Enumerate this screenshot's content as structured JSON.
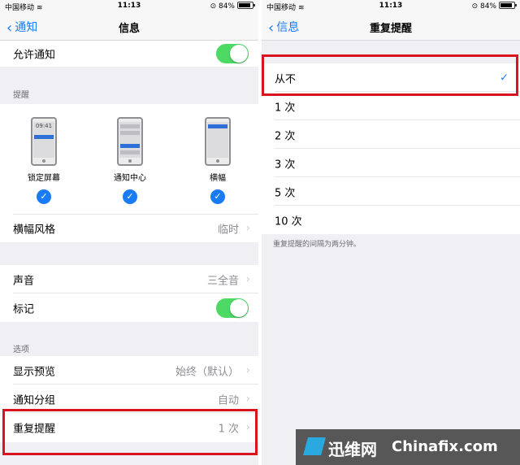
{
  "status_bar": {
    "carrier": "中国移动",
    "time": "11:13",
    "battery": "84%"
  },
  "left": {
    "nav": {
      "back_label": "通知",
      "title": "信息"
    },
    "allow_notifications": {
      "label": "允许通知",
      "on": true
    },
    "alerts_header": "提醒",
    "styles": [
      {
        "label": "锁定屏幕",
        "clock": "09:41",
        "checked": true
      },
      {
        "label": "通知中心",
        "checked": true
      },
      {
        "label": "横幅",
        "checked": true
      }
    ],
    "banner_style": {
      "label": "横幅风格",
      "value": "临时"
    },
    "sounds": {
      "label": "声音",
      "value": "三全音"
    },
    "badges": {
      "label": "标记",
      "on": true
    },
    "options_header": "选项",
    "show_previews": {
      "label": "显示预览",
      "value": "始终（默认）"
    },
    "grouping": {
      "label": "通知分组",
      "value": "自动"
    },
    "repeat_alerts": {
      "label": "重复提醒",
      "value": "1 次"
    }
  },
  "right": {
    "nav": {
      "back_label": "信息",
      "title": "重复提醒"
    },
    "options": [
      {
        "label": "从不",
        "selected": true
      },
      {
        "label": "1 次",
        "selected": false
      },
      {
        "label": "2 次",
        "selected": false
      },
      {
        "label": "3 次",
        "selected": false
      },
      {
        "label": "5 次",
        "selected": false
      },
      {
        "label": "10 次",
        "selected": false
      }
    ],
    "footer": "重复提醒的间隔为两分钟。"
  },
  "watermark": {
    "cn": "迅维网",
    "en": "Chinafix.com"
  },
  "colors": {
    "accent": "#1a7cf5",
    "toggle_on": "#4cd964",
    "highlight": "#d9141e"
  }
}
